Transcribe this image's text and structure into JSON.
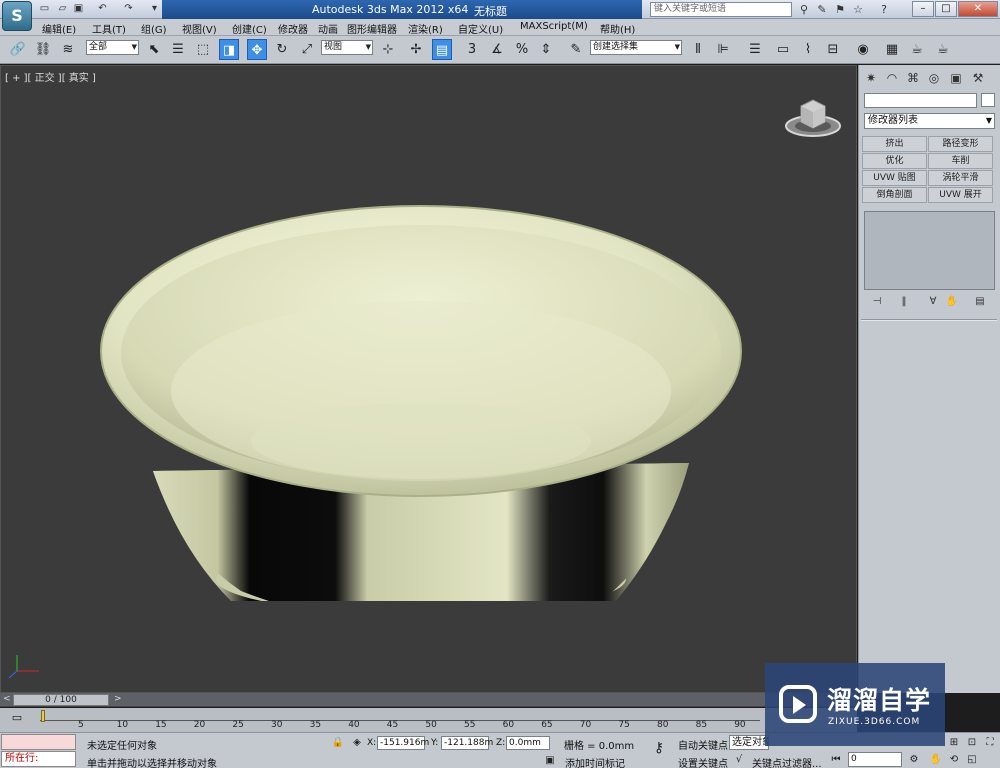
{
  "titlebar": {
    "app_title": "Autodesk 3ds Max  2012 x64",
    "file_name": "无标题",
    "search_placeholder": "键入关键字或短语"
  },
  "menu": [
    "编辑(E)",
    "工具(T)",
    "组(G)",
    "视图(V)",
    "创建(C)",
    "修改器",
    "动画",
    "图形编辑器",
    "渲染(R)",
    "自定义(U)",
    "MAXScript(M)",
    "帮助(H)"
  ],
  "toolbar": {
    "selection_filter": "全部",
    "ref_coord": "视图",
    "named_selection": "创建选择集",
    "snap_label": "3"
  },
  "viewport": {
    "label": "[ + ][ 正交 ][ 真实 ]"
  },
  "command_panel": {
    "modifier_list": "修改器列表",
    "buttons": [
      "挤出",
      "路径变形",
      "优化",
      "车削",
      "UVW 贴图",
      "涡轮平滑",
      "倒角剖面",
      "UVW 展开"
    ]
  },
  "timeline": {
    "frame_display": "0 / 100",
    "ticks": [
      "5",
      "10",
      "15",
      "20",
      "25",
      "30",
      "35",
      "40",
      "45",
      "50",
      "55",
      "60",
      "65",
      "70",
      "75",
      "80",
      "85",
      "90"
    ]
  },
  "status": {
    "maxscript_running": "所在行:",
    "selection_status": "未选定任何对象",
    "prompt": "单击并拖动以选择并移动对象",
    "x_label": "X:",
    "x_value": "-151.916m",
    "y_label": "Y:",
    "y_value": "-121.188m",
    "z_label": "Z:",
    "z_value": "0.0mm",
    "grid": "栅格 = 0.0mm",
    "add_time_tag": "添加时间标记",
    "auto_key": "自动关键点",
    "set_key": "设置关键点",
    "key_mode": "选定对象",
    "key_filters": "关键点过滤器...",
    "frame": "0"
  },
  "watermark": {
    "title": "溜溜自学",
    "url": "ZIXUE.3D66.COM"
  },
  "colors": {
    "viewport_bg": "#3b3b3b",
    "bowl": "#e6e8c6",
    "title_bar": "#1c4b8a"
  }
}
